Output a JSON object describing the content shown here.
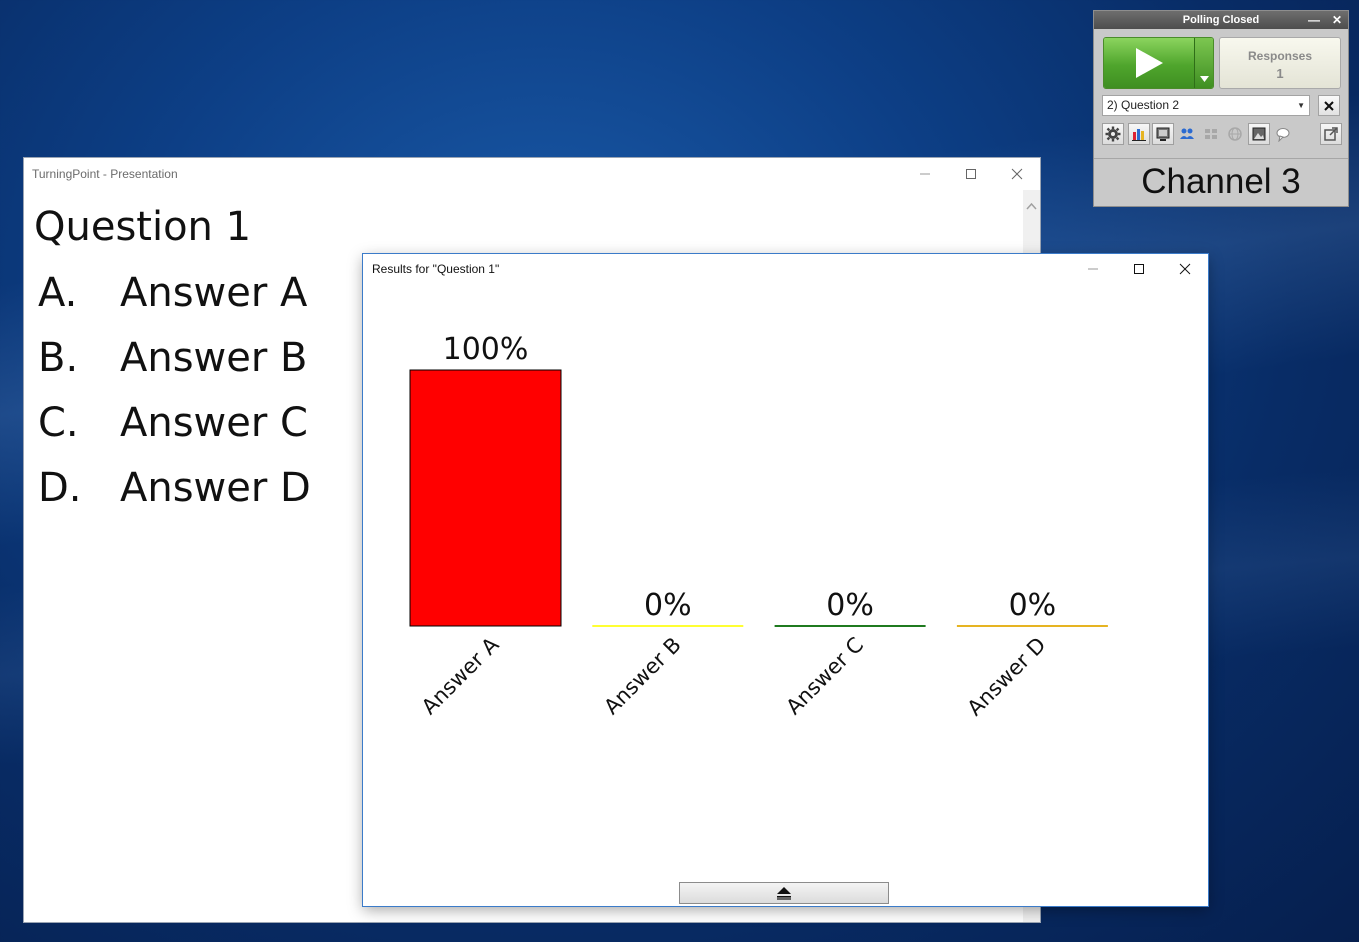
{
  "presentation_window": {
    "title": "TurningPoint - Presentation",
    "slide": {
      "question_title": "Question 1",
      "answers": [
        {
          "letter": "A.",
          "text": "Answer A"
        },
        {
          "letter": "B.",
          "text": "Answer B"
        },
        {
          "letter": "C.",
          "text": "Answer C"
        },
        {
          "letter": "D.",
          "text": "Answer D"
        }
      ]
    }
  },
  "results_window": {
    "title": "Results for \"Question 1\""
  },
  "chart_data": {
    "type": "bar",
    "categories": [
      "Answer A",
      "Answer B",
      "Answer C",
      "Answer D"
    ],
    "values": [
      100,
      0,
      0,
      0
    ],
    "value_labels": [
      "100%",
      "0%",
      "0%",
      "0%"
    ],
    "colors": [
      "#ff0000",
      "#ffff33",
      "#1f7a1f",
      "#e6b422"
    ],
    "ylim": [
      0,
      100
    ],
    "title": "",
    "xlabel": "",
    "ylabel": "",
    "grid": false
  },
  "polling_widget": {
    "status": "Polling Closed",
    "responses_label": "Responses",
    "responses_count": "1",
    "question_selected": "2) Question 2",
    "channel": "Channel 3",
    "tools": [
      "settings-icon",
      "chart-icon",
      "slide-icon",
      "participants-icon",
      "grid-icon",
      "web-icon",
      "image-icon",
      "comment-icon",
      "export-icon"
    ]
  }
}
